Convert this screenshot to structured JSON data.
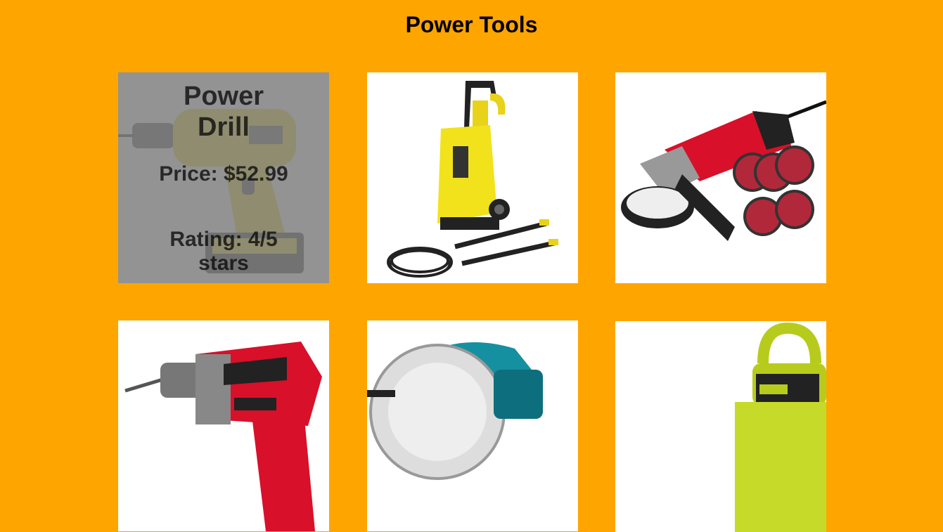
{
  "page": {
    "title": "Power Tools",
    "background_color": "#FFA500"
  },
  "products": [
    {
      "icon": "power-drill-image",
      "name": "Power Drill",
      "price_label": "Price: $52.99",
      "rating_label": "Rating: 4/5 stars",
      "overlay_visible": true
    },
    {
      "icon": "pressure-washer-image"
    },
    {
      "icon": "angle-grinder-image"
    },
    {
      "icon": "hammer-drill-image"
    },
    {
      "icon": "circular-saw-image"
    },
    {
      "icon": "leaf-blower-image"
    }
  ]
}
